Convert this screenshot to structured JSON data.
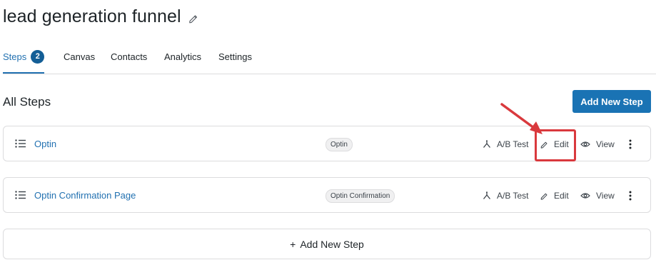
{
  "page": {
    "title": "lead generation funnel"
  },
  "tabs": [
    {
      "label": "Steps",
      "count": "2"
    },
    {
      "label": "Canvas"
    },
    {
      "label": "Contacts"
    },
    {
      "label": "Analytics"
    },
    {
      "label": "Settings"
    }
  ],
  "section": {
    "heading": "All Steps",
    "add_button": "Add New Step"
  },
  "steps": [
    {
      "name": "Optin",
      "badge": "Optin",
      "ab_test": "A/B Test",
      "edit": "Edit",
      "view": "View"
    },
    {
      "name": "Optin Confirmation Page",
      "badge": "Optin Confirmation",
      "ab_test": "A/B Test",
      "edit": "Edit",
      "view": "View"
    }
  ],
  "footer": {
    "add_step_label": "Add New Step",
    "add_step_icon": "+"
  },
  "colors": {
    "accent": "#2271b1",
    "primary_button": "#1a73b4",
    "highlight": "#d9393d"
  }
}
